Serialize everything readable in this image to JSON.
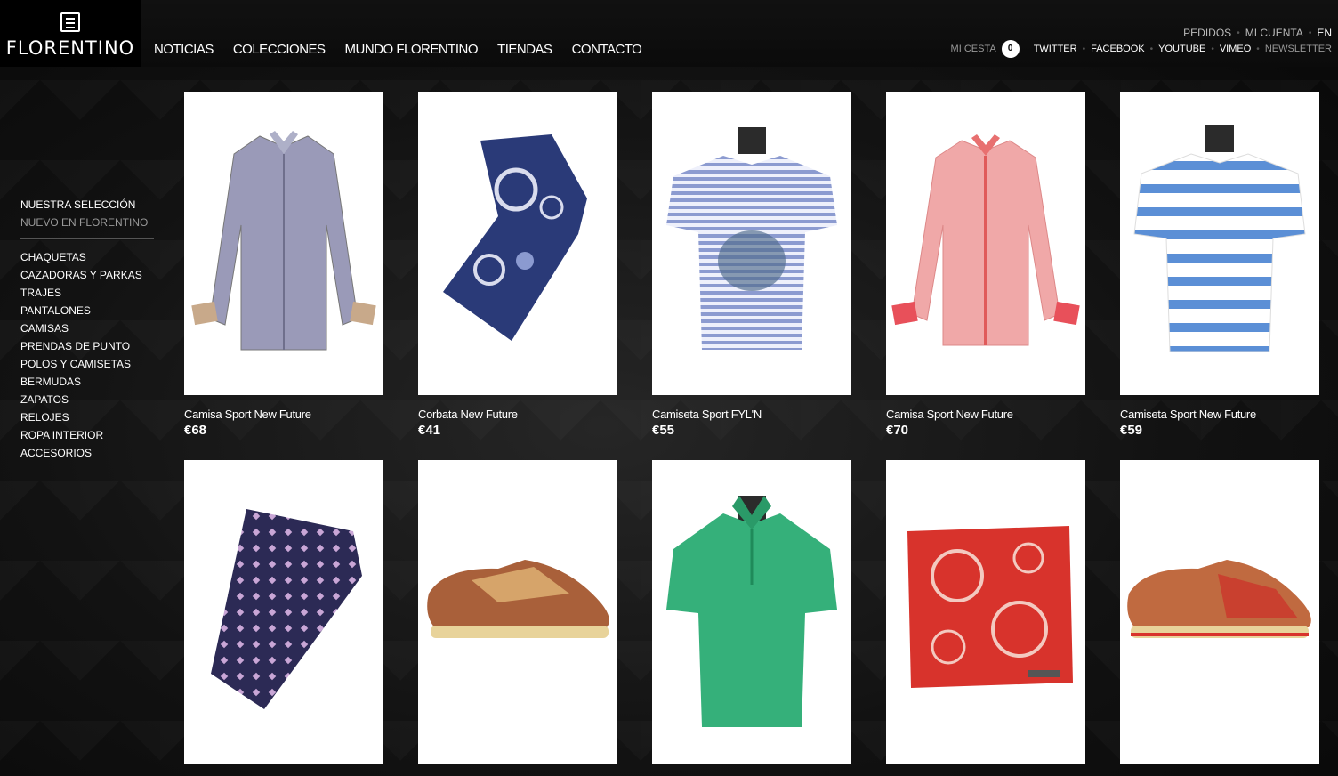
{
  "brand": {
    "name": "FLORENTINO",
    "logo_icon": "menu-box-icon"
  },
  "main_nav": [
    "NOTICIAS",
    "COLECCIONES",
    "MUNDO FLORENTINO",
    "TIENDAS",
    "CONTACTO"
  ],
  "top_links": {
    "orders": "PEDIDOS",
    "account": "MI CUENTA",
    "language": "EN"
  },
  "cart": {
    "label": "MI CESTA",
    "count": "0"
  },
  "social": [
    "TWITTER",
    "FACEBOOK",
    "YOUTUBE",
    "VIMEO"
  ],
  "newsletter": "NEWSLETTER",
  "sidebar": {
    "featured": [
      "NUESTRA SELECCIÓN",
      "NUEVO EN FLORENTINO"
    ],
    "categories": [
      "CHAQUETAS",
      "CAZADORAS Y PARKAS",
      "TRAJES",
      "PANTALONES",
      "CAMISAS",
      "PRENDAS DE PUNTO",
      "POLOS Y CAMISETAS",
      "BERMUDAS",
      "ZAPATOS",
      "RELOJES",
      "ROPA INTERIOR",
      "ACCESORIOS"
    ]
  },
  "products": [
    {
      "name": "Camisa Sport New Future",
      "price": "€68",
      "icon": "shirt-icon",
      "color": "#9a9ab8"
    },
    {
      "name": "Corbata New Future",
      "price": "€41",
      "icon": "tie-icon",
      "color": "#2a3a78"
    },
    {
      "name": "Camiseta Sport FYL'N",
      "price": "€55",
      "icon": "tshirt-icon",
      "color": "#8c9bd0"
    },
    {
      "name": "Camisa Sport New Future",
      "price": "€70",
      "icon": "shirt-icon",
      "color": "#f0a8a8"
    },
    {
      "name": "Camiseta Sport New Future",
      "price": "€59",
      "icon": "tshirt-icon",
      "color": "#5b8fd6"
    },
    {
      "name": "",
      "price": "",
      "icon": "tie-icon",
      "color": "#2c2a55"
    },
    {
      "name": "",
      "price": "",
      "icon": "shoe-icon",
      "color": "#a9603a"
    },
    {
      "name": "",
      "price": "",
      "icon": "polo-icon",
      "color": "#35b07a"
    },
    {
      "name": "",
      "price": "",
      "icon": "pocket-square-icon",
      "color": "#d8332c"
    },
    {
      "name": "",
      "price": "",
      "icon": "shoe-icon",
      "color": "#c9402f"
    }
  ]
}
